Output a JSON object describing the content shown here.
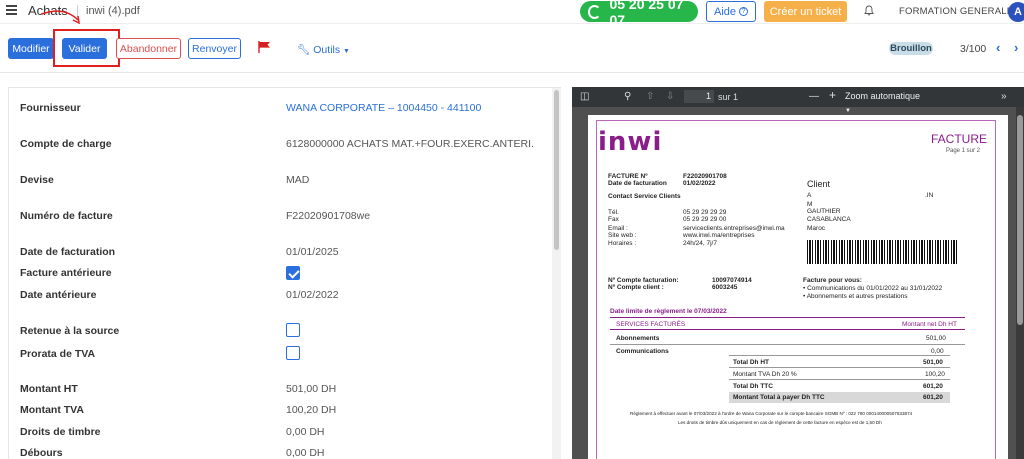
{
  "header": {
    "app_title": "Achats",
    "doc_name": "inwi (4).pdf",
    "phone": "05 20 25 07 07",
    "help_label": "Aide",
    "help_icon": "question-circle-icon",
    "ticket_label": "Créer un ticket",
    "company": "FORMATION GENERALE",
    "avatar_letter": "A"
  },
  "toolbar": {
    "modifier": "Modifier",
    "valider": "Valider",
    "abandonner": "Abandonner",
    "renvoyer": "Renvoyer",
    "outils": "Outils",
    "status": "Brouillon",
    "pager": "3/100"
  },
  "form": [
    {
      "label": "Fournisseur",
      "value": "WANA CORPORATE – 1004450 - 441100",
      "link": true
    },
    {
      "label": "Compte de charge",
      "value": "6128000000 ACHATS MAT.+FOUR.EXERC.ANTERI."
    },
    {
      "label": "Devise",
      "value": "MAD"
    },
    {
      "label": "Numéro de facture",
      "value": "F22020901708we"
    },
    {
      "label": "Date de facturation",
      "value": "01/01/2025"
    },
    {
      "label": "Facture antérieure",
      "checkbox": true,
      "checked": true
    },
    {
      "label": "Date antérieure",
      "value": "01/02/2022"
    },
    {
      "label": "Retenue à la source",
      "checkbox": true,
      "checked": false
    },
    {
      "label": "Prorata de TVA",
      "checkbox": true,
      "checked": false
    },
    {
      "label": "Montant HT",
      "value": "501,00 DH"
    },
    {
      "label": "Montant TVA",
      "value": "100,20 DH"
    },
    {
      "label": "Droits de timbre",
      "value": "0,00 DH"
    },
    {
      "label": "Débours",
      "value": "0,00 DH"
    }
  ],
  "pdf": {
    "page_num": "1",
    "page_total": "sur 1",
    "zoom": "Zoom automatique",
    "logo": "inwi",
    "title": "FACTURE",
    "page_label": "Page 1 sur 2",
    "fields": {
      "facture_no_lbl": "FACTURE Nº",
      "facture_no": "F22020901708",
      "date_lbl": "Date de facturation",
      "date": "01/02/2022",
      "contact": "Contact Service Clients",
      "tel_lbl": "Tél.",
      "tel": "05 29 29 29 29",
      "fax_lbl": "Fax",
      "fax": "05 29 29 29 00",
      "email_lbl": "Email :",
      "email": "serviceclients.entreprises@inwi.ma",
      "site_lbl": "Site web :",
      "site": "www.inwi.ma/entreprises",
      "hours_lbl": "Horaires :",
      "hours": "24h/24, 7j/7",
      "client_lbl": "Client",
      "client_a": "A",
      "client_in": ".IN",
      "client_m": "M",
      "client_name": "GAUTHIER",
      "client_city": "CASABLANCA",
      "client_country": "Maroc",
      "compte_fact_lbl": "Nº Compte facturation:",
      "compte_fact": "10097074914",
      "compte_client_lbl": "Nº Compte client :",
      "compte_client": "6003245",
      "pour_vous": "Facture pour vous:",
      "pour_vous_1": "• Communications du 01/01/2022 au 31/01/2022",
      "pour_vous_2": "• Abonnements et autres prestations",
      "limite": "Date limite de règlement  le 07/03/2022",
      "services_hdr": "SERVICES FACTURÉS",
      "montant_hdr": "Montant net Dh HT",
      "abonnements_lbl": "Abonnements",
      "abonnements": "501,00",
      "communications_lbl": "Communications",
      "communications": "0,00",
      "total_ht_lbl": "Total Dh HT",
      "total_ht": "501,00",
      "tva_lbl": "Montant TVA Dh 20 %",
      "tva": "100,20",
      "ttc_lbl": "Total Dh TTC",
      "ttc": "601,20",
      "pay_lbl": "Montant Total à payer Dh TTC",
      "pay": "601,20",
      "footer_1": "Règlement à effectuer avant le 07/03/2022 à l'ordre de Wana Corporate sur le compte bancaire SGMB Nº : 022 780 000140000507633874",
      "footer_2": "Les droits de timbre dûs uniquement en cas de règlement de cette facture en espèce est de 1,50 Dh"
    }
  },
  "colors": {
    "primary": "#2a6fdb",
    "phone_green": "#27b64a",
    "ticket_orange": "#f6b04a",
    "danger": "#e05050",
    "inwi_purple": "#8a1d8a"
  }
}
